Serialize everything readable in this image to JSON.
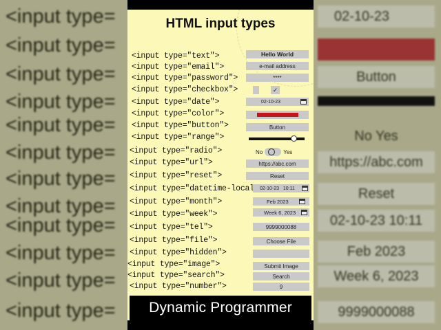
{
  "title": "HTML input types",
  "footer": "Dynamic Programmer",
  "colors": {
    "card_bg": "#fbf8b8",
    "control_bg": "#c9c9c9",
    "color_swatch": "#c4141c",
    "footer_bg": "#000000"
  },
  "rows": [
    {
      "label": "<input type=\"text\">",
      "value": "Hello World"
    },
    {
      "label": "<input type=\"email\">",
      "value": "e-mail address"
    },
    {
      "label": "<input type=\"password\">",
      "value": "****"
    },
    {
      "label": "<input type=\"checkbox\">",
      "value": "✓"
    },
    {
      "label": "<input type=\"date\">",
      "value": "02-10-23",
      "icon": "calendar-icon"
    },
    {
      "label": "<input type=\"color\">",
      "value": "#c4141c"
    },
    {
      "label": "<input type=\"button\">",
      "value": "Button"
    },
    {
      "label": "<input type=\"range\">",
      "value": 0.85
    },
    {
      "label": "<input type=\"radio\">",
      "no": "No",
      "yes": "Yes"
    },
    {
      "label": "<input type=\"url\">",
      "value": "https://abc.com"
    },
    {
      "label": "<input type=\"reset\">",
      "value": "Reset"
    },
    {
      "label": "<input type=\"datetime-local\">",
      "value": "02-10-23   10:11",
      "icon": "calendar-icon"
    },
    {
      "label": "<input type=\"month\">",
      "value": "Feb 2023",
      "icon": "calendar-icon"
    },
    {
      "label": "<input type=\"week\">",
      "value": "Week 6, 2023",
      "icon": "calendar-icon"
    },
    {
      "label": "<input type=\"tel\">",
      "value": "9999000088"
    },
    {
      "label": "<input type=\"file\">",
      "value": "Choose File"
    },
    {
      "label": "<input type=\"hidden\">",
      "value": ""
    },
    {
      "label": "<input type=\"image\">",
      "value": "Submit Image"
    },
    {
      "label": "<input type=\"search\">",
      "value": "Search"
    },
    {
      "label": "<input type=\"number\">",
      "value": "9"
    }
  ],
  "background": {
    "left_lines": [
      "<input type=",
      "<input type=",
      "<input type=",
      "<input type=",
      "<input type=",
      "<input type=",
      "<input type=",
      "<input type=",
      "<input type=",
      "<input type=",
      "<input type=",
      "<input type=",
      "<input type=",
      "<input type=",
      "<input type=",
      "<input type=",
      "<input type=",
      "<input type=",
      "<input type="
    ],
    "right_items": [
      "02-10-23",
      "",
      "Button",
      "",
      "No   Yes",
      "https://abc.com",
      "Reset",
      "02-10-23   10:11",
      "Feb 2023",
      "Week 6, 2023",
      "9999000088"
    ]
  }
}
